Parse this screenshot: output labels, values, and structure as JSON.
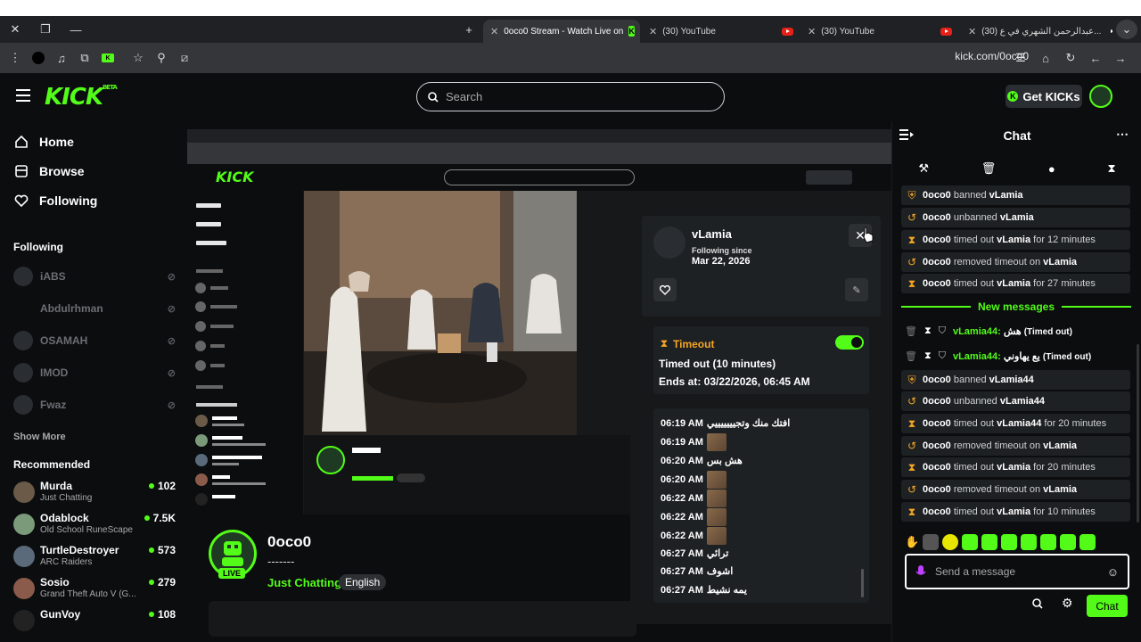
{
  "browser": {
    "tabs": [
      {
        "title": "0oco0 Stream - Watch Live on",
        "active": true
      },
      {
        "title": "(30) YouTube"
      },
      {
        "title": "(30) YouTube"
      },
      {
        "title": "(30) عبدالرحمن الشهري في ع..."
      }
    ],
    "url": "kick.com/0oco0"
  },
  "header": {
    "logo": "KICK",
    "logo_beta": "BETA",
    "search_placeholder": "Search",
    "get_kicks_label": "Get KICKs"
  },
  "sidebar": {
    "nav": [
      {
        "label": "Home",
        "icon": "home-icon"
      },
      {
        "label": "Browse",
        "icon": "browse-icon"
      },
      {
        "label": "Following",
        "icon": "heart-icon"
      }
    ],
    "following_heading": "Following",
    "following": [
      "iABS",
      "Abdulrhman",
      "OSAMAH",
      "IMOD",
      "Fwaz"
    ],
    "show_more": "Show More",
    "recommended_heading": "Recommended",
    "recommended": [
      {
        "name": "Murda",
        "category": "Just Chatting",
        "viewers": "102"
      },
      {
        "name": "Odablock",
        "category": "Old School RuneScape",
        "viewers": "7.5K"
      },
      {
        "name": "TurtleDestroyer",
        "category": "ARC Raiders",
        "viewers": "573"
      },
      {
        "name": "Sosio",
        "category": "Grand Theft Auto V (G...",
        "viewers": "279"
      },
      {
        "name": "GunVoy",
        "category": "",
        "viewers": "108"
      }
    ]
  },
  "stream": {
    "channel": "0oco0",
    "title": "-------",
    "live_badge": "LIVE",
    "category": "Just Chatting",
    "tag": "English"
  },
  "popup": {
    "username": "vLamia",
    "following_since_label": "Following since",
    "following_since_date": "Mar 22, 2026",
    "timeout_heading": "Timeout",
    "timeout_duration": "Timed out (10 minutes)",
    "timeout_ends": "Ends at: 03/22/2026, 06:45 AM",
    "messages": [
      {
        "time": "06:19 AM",
        "text": "افتك منك وتجيييييييي",
        "thumb": false
      },
      {
        "time": "06:19 AM",
        "text": "",
        "thumb": true
      },
      {
        "time": "06:20 AM",
        "text": "هش بس",
        "thumb": false
      },
      {
        "time": "06:20 AM",
        "text": "",
        "thumb": true
      },
      {
        "time": "06:22 AM",
        "text": "",
        "thumb": true
      },
      {
        "time": "06:22 AM",
        "text": "",
        "thumb": true
      },
      {
        "time": "06:22 AM",
        "text": "",
        "thumb": true
      },
      {
        "time": "06:27 AM",
        "text": "ترائي",
        "thumb": false
      },
      {
        "time": "06:27 AM",
        "text": "اشوف",
        "thumb": false
      },
      {
        "time": "06:27 AM",
        "text": "يمه نشيط",
        "thumb": false
      }
    ]
  },
  "chat": {
    "title": "Chat",
    "mod_log_top": [
      {
        "icon": "ban-icon",
        "actor": "0oco0",
        "action": "banned",
        "target": "vLamia",
        "suffix": ""
      },
      {
        "icon": "unban-icon",
        "actor": "0oco0",
        "action": "unbanned",
        "target": "vLamia",
        "suffix": ""
      },
      {
        "icon": "hourglass-icon",
        "actor": "0oco0",
        "action": "timed out",
        "target": "vLamia",
        "suffix": "for 12 minutes"
      },
      {
        "icon": "unban-icon",
        "actor": "0oco0",
        "action": "removed timeout on",
        "target": "vLamia",
        "suffix": ""
      },
      {
        "icon": "hourglass-icon",
        "actor": "0oco0",
        "action": "timed out",
        "target": "vLamia",
        "suffix": "for 27 minutes"
      }
    ],
    "new_messages_label": "New messages",
    "new_messages": [
      {
        "user": "vLamia44:",
        "text": "هش",
        "note": "(Timed out)"
      },
      {
        "user": "vLamia44:",
        "text": "يع يهاوني",
        "note": "(Timed out)"
      }
    ],
    "mod_log_bottom": [
      {
        "icon": "ban-icon",
        "actor": "0oco0",
        "action": "banned",
        "target": "vLamia44",
        "suffix": ""
      },
      {
        "icon": "unban-icon",
        "actor": "0oco0",
        "action": "unbanned",
        "target": "vLamia44",
        "suffix": ""
      },
      {
        "icon": "hourglass-icon",
        "actor": "0oco0",
        "action": "timed out",
        "target": "vLamia44",
        "suffix": "for 20 minutes"
      },
      {
        "icon": "unban-icon",
        "actor": "0oco0",
        "action": "removed timeout on",
        "target": "vLamia",
        "suffix": ""
      },
      {
        "icon": "hourglass-icon",
        "actor": "0oco0",
        "action": "timed out",
        "target": "vLamia",
        "suffix": "for 20 minutes"
      },
      {
        "icon": "unban-icon",
        "actor": "0oco0",
        "action": "removed timeout on",
        "target": "vLamia",
        "suffix": ""
      },
      {
        "icon": "hourglass-icon",
        "actor": "0oco0",
        "action": "timed out",
        "target": "vLamia",
        "suffix": "for 10 minutes"
      }
    ],
    "input_placeholder": "Send a message",
    "send_label": "Chat"
  },
  "colors": {
    "brand": "#53fc18",
    "mod": "#f5a623"
  }
}
